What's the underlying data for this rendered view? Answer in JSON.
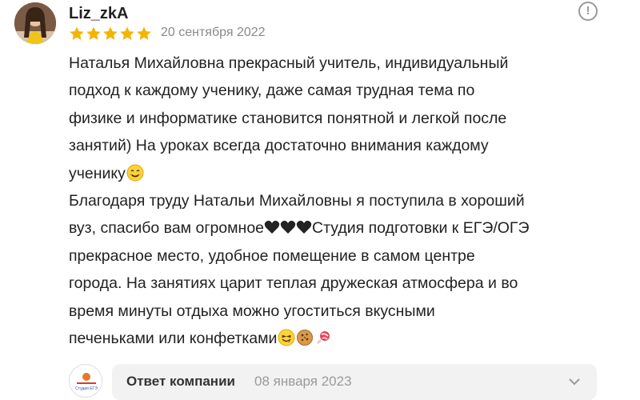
{
  "review": {
    "author": "Liz_zkA",
    "rating": 5,
    "date": "20 сентября 2022",
    "paragraph1": [
      "Наталья Михайловна прекрасный учитель, индивидуальный",
      "подход к каждому ученику, даже самая трудная тема по",
      "физике и информатике становится понятной и легкой после",
      "занятий) На уроках всегда достаточно внимания каждому",
      "ученику"
    ],
    "paragraph2": [
      "Благодаря труду Натальи Михайловны я поступила в хороший",
      "вуз, спасибо вам огромное",
      "Студия подготовки к ЕГЭ/ОГЭ",
      "прекрасное место, удобное помещение в самом центре",
      "города. На занятиях царит теплая дружеская атмосфера и во",
      "время минуты отдыха можно угоститься вкусными",
      "печеньками или конфетками"
    ],
    "more_icon": "!",
    "icons": {
      "more": "info-circle-icon",
      "star_color": "#f5b400",
      "heart_color": "#222222"
    }
  },
  "company_reply": {
    "label": "Ответ компании",
    "date": "08 января 2023",
    "logo_text": "Студия ЕГЭ"
  }
}
